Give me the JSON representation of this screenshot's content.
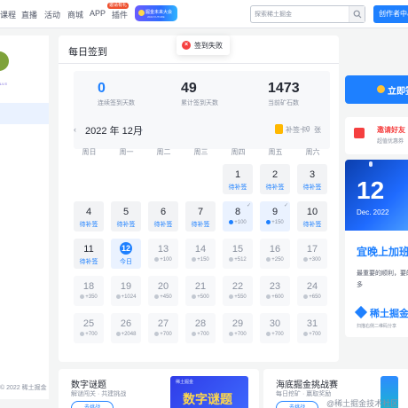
{
  "nav": {
    "items": [
      "课程",
      "直播",
      "活动",
      "商城",
      "APP",
      "插件"
    ],
    "app_badge": "邀请有礼",
    "banner_title": "掘金未来大会",
    "banner_sub": "2022 FUTURE",
    "search_placeholder": "探索稀土掘金",
    "creator_label": "创作者中心"
  },
  "sidebar": {
    "tag": "LV.5",
    "footer": "© 2022 稀土掘金"
  },
  "toast": {
    "message": "签到失败"
  },
  "panel": {
    "title": "每日签到",
    "stats": [
      {
        "value": "0",
        "label": "连续签到天数",
        "color": "#1e80ff"
      },
      {
        "value": "49",
        "label": "累计签到天数",
        "color": "#252933"
      },
      {
        "value": "1473",
        "label": "当前矿石数",
        "color": "#252933"
      }
    ],
    "month": "2022 年 12月",
    "prev_arrow": "‹",
    "next_arrow": "›",
    "makeup_card_label": "补签卡:",
    "makeup_card_count": "0",
    "makeup_card_unit": "张",
    "weekdays": [
      "周日",
      "周一",
      "周二",
      "周三",
      "周四",
      "周五",
      "周六"
    ],
    "days": [
      {
        "d": "1",
        "status": "待补签",
        "type": "resign"
      },
      {
        "d": "2",
        "status": "待补签",
        "type": "resign"
      },
      {
        "d": "3",
        "status": "待补签",
        "type": "resign"
      },
      {
        "d": "4",
        "status": "待补签",
        "type": "resign"
      },
      {
        "d": "5",
        "status": "待补签",
        "type": "resign"
      },
      {
        "d": "6",
        "status": "待补签",
        "type": "resign"
      },
      {
        "d": "7",
        "status": "待补签",
        "type": "resign"
      },
      {
        "d": "8",
        "points": "+100",
        "type": "signed"
      },
      {
        "d": "9",
        "points": "+150",
        "type": "signed"
      },
      {
        "d": "10",
        "status": "待补签",
        "type": "resign"
      },
      {
        "d": "11",
        "status": "待补签",
        "type": "resign"
      },
      {
        "d": "12",
        "status": "今日",
        "type": "today"
      },
      {
        "d": "13",
        "points": "+100",
        "type": "future"
      },
      {
        "d": "14",
        "points": "+150",
        "type": "future"
      },
      {
        "d": "15",
        "points": "+512",
        "type": "future"
      },
      {
        "d": "16",
        "points": "+250",
        "type": "future"
      },
      {
        "d": "17",
        "points": "+300",
        "type": "future"
      },
      {
        "d": "18",
        "points": "+350",
        "type": "future"
      },
      {
        "d": "19",
        "points": "+1024",
        "type": "future"
      },
      {
        "d": "20",
        "points": "+450",
        "type": "future"
      },
      {
        "d": "21",
        "points": "+500",
        "type": "future"
      },
      {
        "d": "22",
        "points": "+550",
        "type": "future"
      },
      {
        "d": "23",
        "points": "+600",
        "type": "future"
      },
      {
        "d": "24",
        "points": "+650",
        "type": "future"
      },
      {
        "d": "25",
        "points": "+700",
        "type": "future"
      },
      {
        "d": "26",
        "points": "+2048",
        "type": "future"
      },
      {
        "d": "27",
        "points": "+700",
        "type": "future"
      },
      {
        "d": "28",
        "points": "+700",
        "type": "future"
      },
      {
        "d": "29",
        "points": "+700",
        "type": "future"
      },
      {
        "d": "30",
        "points": "+700",
        "type": "future"
      },
      {
        "d": "31",
        "points": "+700",
        "type": "future"
      }
    ]
  },
  "right": {
    "sign_button": "立即签到",
    "invite_title": "邀请好友",
    "invite_sub": "超值优惠券",
    "ad_day": "12",
    "ad_month": "Dec. 2022",
    "ad_headline": "宜晚上加班",
    "ad_desc1": "最重要的顺利，要的",
    "ad_desc2": "多",
    "ad_brand": "稀土掘金",
    "ad_qr": "扫描右侧二维码分享"
  },
  "bottom": {
    "card1_title": "数字谜题",
    "card1_sub": "解谜闯关 · 共建挑战",
    "card1_btn": "去挑战",
    "card1_thumb_tag": "稀土掘金",
    "card1_thumb_title": "数字谜题",
    "card2_title": "海底掘金挑战赛",
    "card2_sub": "每日挖矿 · 赢取奖励",
    "card2_btn": "去挑战"
  },
  "watermark": "@稀土掘金技术社区"
}
